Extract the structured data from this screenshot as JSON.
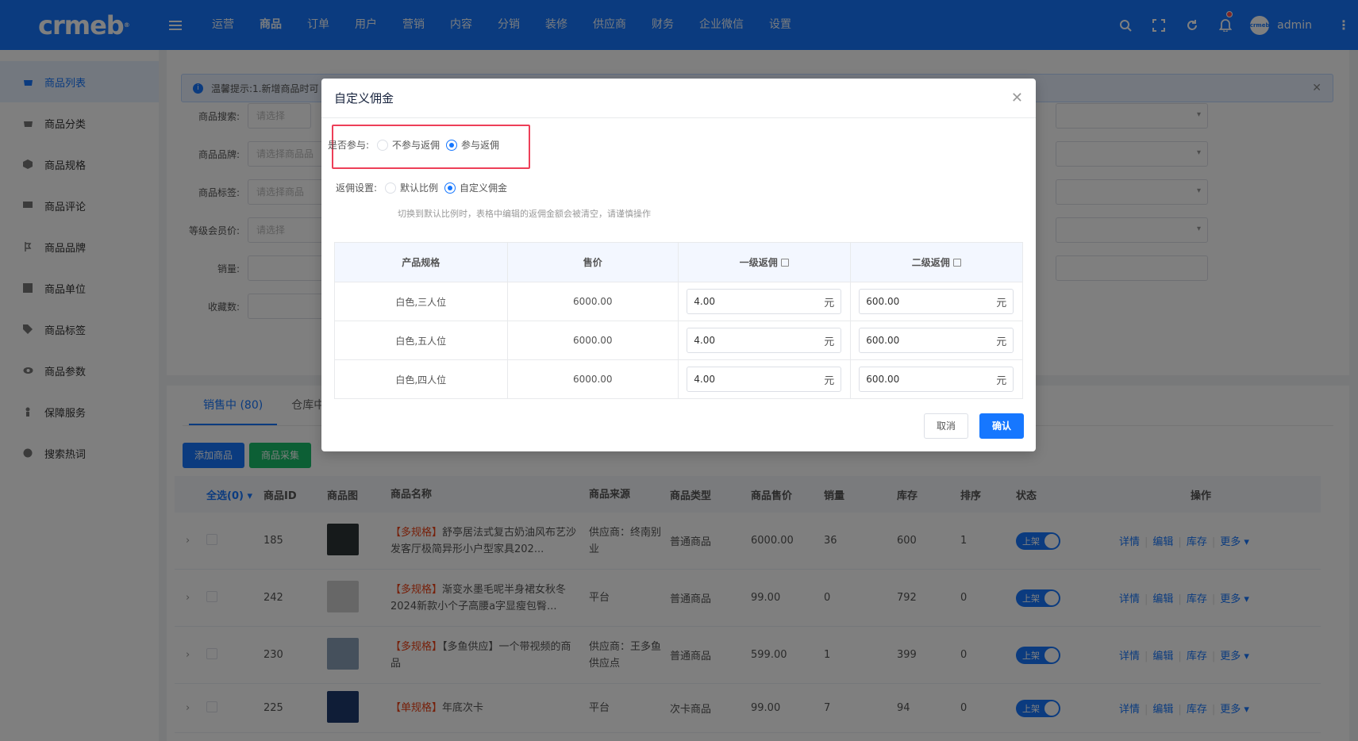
{
  "app": {
    "logo": "crmeb",
    "nav": [
      "运营",
      "商品",
      "订单",
      "用户",
      "营销",
      "内容",
      "分销",
      "装修",
      "供应商",
      "财务",
      "企业微信",
      "设置"
    ],
    "active_nav": "商品",
    "username": "admin",
    "avatar_text": "crmeb"
  },
  "sidebar": {
    "items": [
      {
        "label": "商品列表",
        "icon": "bag-icon"
      },
      {
        "label": "商品分类",
        "icon": "category-icon"
      },
      {
        "label": "商品规格",
        "icon": "cube-icon"
      },
      {
        "label": "商品评论",
        "icon": "comment-icon"
      },
      {
        "label": "商品品牌",
        "icon": "brand-icon"
      },
      {
        "label": "商品单位",
        "icon": "grid-icon"
      },
      {
        "label": "商品标签",
        "icon": "tag-icon"
      },
      {
        "label": "商品参数",
        "icon": "eye-icon"
      },
      {
        "label": "保障服务",
        "icon": "shield-icon"
      },
      {
        "label": "搜索热词",
        "icon": "globe-icon"
      }
    ]
  },
  "notice": {
    "text": "温馨提示:1.新增商品时可"
  },
  "filters": {
    "search_label": "商品搜索:",
    "search_placeholder": "请选择",
    "brand_label": "商品品牌:",
    "brand_placeholder": "请选择商品品",
    "tag_label": "商品标签:",
    "tag_placeholder": "请选择商品",
    "member_label": "等级会员价:",
    "member_placeholder": "请选择",
    "sales_label": "销量:",
    "fav_label": "收藏数:"
  },
  "list": {
    "tabs": [
      "销售中 (80)",
      "仓库中"
    ],
    "add_button": "添加商品",
    "collect_button": "商品采集",
    "headers": [
      "全选(0)",
      "商品ID",
      "商品图",
      "商品名称",
      "商品来源",
      "商品类型",
      "商品售价",
      "销量",
      "库存",
      "排序",
      "状态",
      "操作"
    ],
    "rows": [
      {
        "id": "185",
        "tag": "【多规格】",
        "name": "舒亭居法式复古奶油风布艺沙发客厅极简异形小户型家具202...",
        "source": "供应商：终南别业",
        "type": "普通商品",
        "price": "6000.00",
        "sales": "36",
        "stock": "600",
        "sort": "1",
        "status": "上架"
      },
      {
        "id": "242",
        "tag": "【多规格】",
        "name": "渐变水墨毛呢半身裙女秋冬2024新款小个子高腰a字显瘦包臀...",
        "source": "平台",
        "type": "普通商品",
        "price": "99.00",
        "sales": "0",
        "stock": "792",
        "sort": "0",
        "status": "上架"
      },
      {
        "id": "230",
        "tag": "【多规格】",
        "name": "【多鱼供应】一个带视频的商品",
        "source": "供应商：王多鱼供应点",
        "type": "普通商品",
        "price": "599.00",
        "sales": "1",
        "stock": "399",
        "sort": "0",
        "status": "上架"
      },
      {
        "id": "225",
        "tag": "【单规格】",
        "name": "年底次卡",
        "source": "平台",
        "type": "次卡商品",
        "price": "99.00",
        "sales": "7",
        "stock": "94",
        "sort": "0",
        "status": "上架"
      }
    ],
    "ops": {
      "detail": "详情",
      "edit": "编辑",
      "stock": "库存",
      "more": "更多"
    }
  },
  "modal": {
    "title": "自定义佣金",
    "participate_label": "是否参与:",
    "participate_options": [
      "不参与返佣",
      "参与返佣"
    ],
    "participate_selected": "参与返佣",
    "setting_label": "返佣设置:",
    "setting_options": [
      "默认比例",
      "自定义佣金"
    ],
    "setting_selected": "自定义佣金",
    "hint": "切换到默认比例时，表格中编辑的返佣金额会被清空，请谨慎操作",
    "table_headers": [
      "产品规格",
      "售价",
      "一级返佣",
      "二级返佣"
    ],
    "table_rows": [
      {
        "spec": "白色,三人位",
        "price": "6000.00",
        "level1": "4.00",
        "level2": "600.00"
      },
      {
        "spec": "白色,五人位",
        "price": "6000.00",
        "level1": "4.00",
        "level2": "600.00"
      },
      {
        "spec": "白色,四人位",
        "price": "6000.00",
        "level1": "4.00",
        "level2": "600.00"
      }
    ],
    "unit": "元",
    "cancel": "取消",
    "confirm": "确认"
  },
  "colors": {
    "primary": "#1677ff",
    "highlight": "#ed3f58",
    "success": "#19be6b",
    "tag": "#ed4014"
  }
}
